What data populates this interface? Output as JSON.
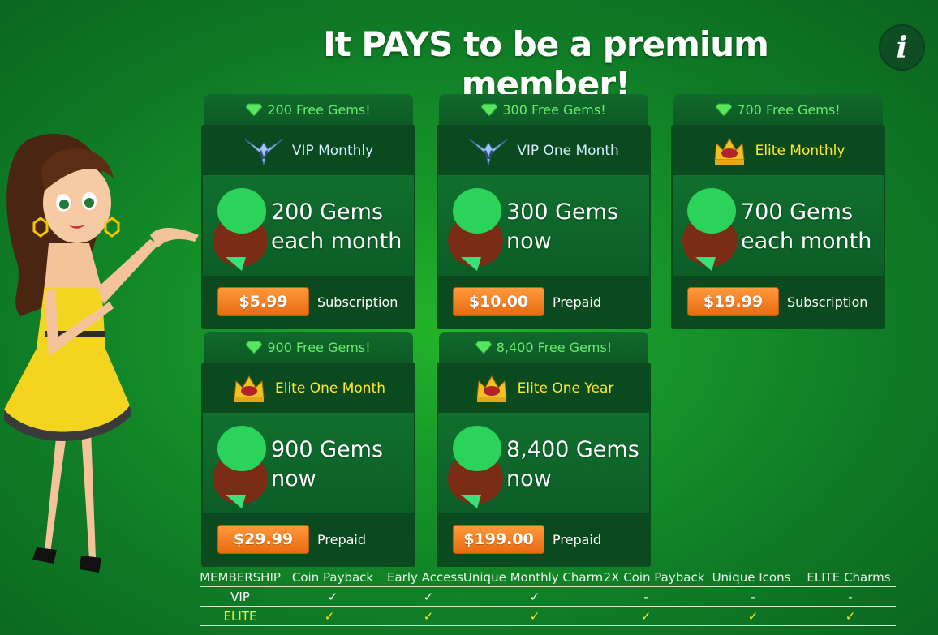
{
  "headline": "It PAYS to be a premium member!",
  "info_button": "i",
  "plans": [
    {
      "gems_tab": "200 Free Gems!",
      "tier": "vip",
      "title": "VIP Monthly",
      "amount_line1": "200 Gems",
      "amount_line2": "each month",
      "price": "$5.99",
      "type": "Subscription"
    },
    {
      "gems_tab": "300 Free Gems!",
      "tier": "vip",
      "title": "VIP One Month",
      "amount_line1": "300 Gems",
      "amount_line2": "now",
      "price": "$10.00",
      "type": "Prepaid"
    },
    {
      "gems_tab": "700 Free Gems!",
      "tier": "elite",
      "title": "Elite Monthly",
      "amount_line1": "700 Gems",
      "amount_line2": "each month",
      "price": "$19.99",
      "type": "Subscription"
    },
    {
      "gems_tab": "900 Free Gems!",
      "tier": "elite",
      "title": "Elite One Month",
      "amount_line1": "900 Gems",
      "amount_line2": "now",
      "price": "$29.99",
      "type": "Prepaid"
    },
    {
      "gems_tab": "8,400 Free Gems!",
      "tier": "elite",
      "title": "Elite One Year",
      "amount_line1": "8,400 Gems",
      "amount_line2": "now",
      "price": "$199.00",
      "type": "Prepaid"
    }
  ],
  "comparison": {
    "headers": [
      "MEMBERSHIP",
      "Coin Payback",
      "Early Access",
      "Unique Monthly Charm",
      "2X Coin Payback",
      "Unique Icons",
      "ELITE Charms"
    ],
    "rows": [
      {
        "label": "VIP",
        "cells": [
          "✓",
          "✓",
          "✓",
          "-",
          "-",
          "-"
        ]
      },
      {
        "label": "ELITE",
        "cells": [
          "✓",
          "✓",
          "✓",
          "✓",
          "✓",
          "✓"
        ]
      }
    ]
  },
  "colors": {
    "gem_tab_text": "#67ec6f",
    "elite_title": "#ffe92a",
    "price_button": "#f07a1c",
    "background": "#17962a"
  },
  "icons": {
    "gem": "green-gem-icon",
    "vip": "vip-wings-badge-icon",
    "elite": "gold-crown-icon",
    "bag": "gem-sack-icon"
  }
}
